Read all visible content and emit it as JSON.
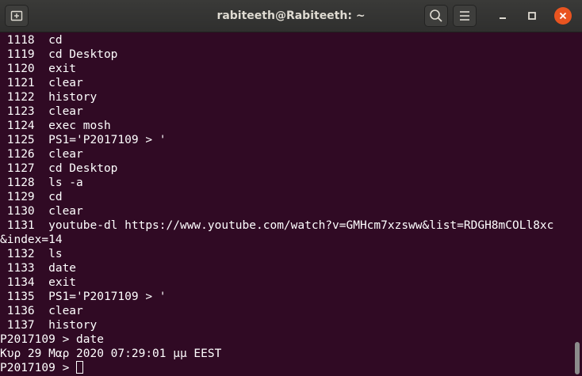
{
  "window": {
    "title": "rabiteeth@Rabiteeth: ~"
  },
  "icons": {
    "new_tab": "new-tab-icon",
    "search": "search-icon",
    "menu": "hamburger-menu-icon",
    "minimize": "minimize-icon",
    "maximize": "maximize-icon",
    "close": "close-icon"
  },
  "colors": {
    "terminal_background": "#300a24",
    "close_button": "#e95420",
    "text": "#ffffff"
  },
  "terminal": {
    "lines": [
      " 1118  cd",
      " 1119  cd Desktop",
      " 1120  exit",
      " 1121  clear",
      " 1122  history",
      " 1123  clear",
      " 1124  exec mosh",
      " 1125  PS1='P2017109 > '",
      " 1126  clear",
      " 1127  cd Desktop",
      " 1128  ls -a",
      " 1129  cd",
      " 1130  clear",
      " 1131  youtube-dl https://www.youtube.com/watch?v=GMHcm7xzsww&list=RDGH8mCOLl8xc",
      "&index=14",
      " 1132  ls",
      " 1133  date",
      " 1134  exit",
      " 1135  PS1='P2017109 > '",
      " 1136  clear",
      " 1137  history",
      "P2017109 > date",
      "Κυρ 29 Μαρ 2020 07:29:01 μμ EEST"
    ],
    "prompt": "P2017109 > "
  }
}
